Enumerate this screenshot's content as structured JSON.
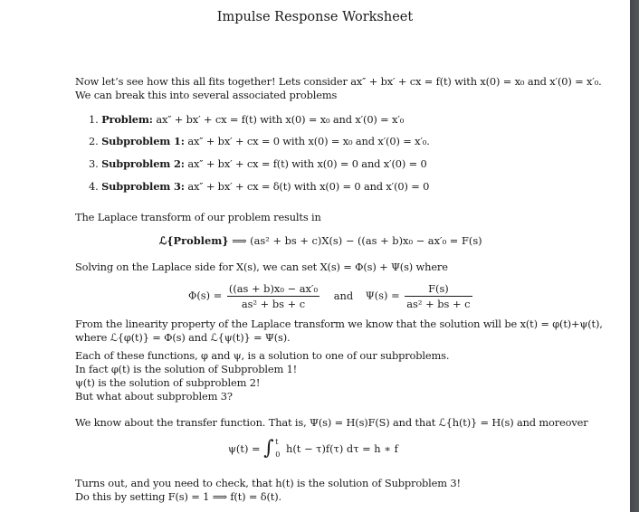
{
  "document": {
    "title": "Impulse Response Worksheet",
    "intro_line1": "Now let’s see how this all fits together! Lets consider ax″ + bx′ + cx = f(t) with x(0) = x₀ and x′(0) = x′₀.",
    "intro_line2": "We can break this into several associated problems",
    "problems": [
      {
        "number": "1.",
        "label": "Problem:",
        "text": "ax″ + bx′ + cx = f(t) with x(0) = x₀ and x′(0) = x′₀"
      },
      {
        "number": "2.",
        "label": "Subproblem 1:",
        "text": "ax″ + bx′ + cx = 0 with x(0) = x₀ and x′(0) = x′₀."
      },
      {
        "number": "3.",
        "label": "Subproblem 2:",
        "text": "ax″ + bx′ + cx = f(t) with x(0) = 0 and x′(0) = 0"
      },
      {
        "number": "4.",
        "label": "Subproblem 3:",
        "text": "ax″ + bx′ + cx = δ(t) with x(0) = 0 and x′(0) = 0"
      }
    ],
    "laplace_intro": "The Laplace transform of our problem results in",
    "laplace_eq_lhs": "ℒ{Problem}",
    "laplace_eq_rhs": "⟹  (as² + bs + c)X(s) − ((as + b)x₀ − ax′₀ = F(s)",
    "solving_line": "Solving on the Laplace side for X(s), we can set X(s) = Φ(s) + Ψ(s) where",
    "phi_lhs": "Φ(s) =",
    "phi_num": "((as + b)x₀ − ax′₀",
    "phi_den": "as² + bs + c",
    "and_word": "and",
    "psi_lhs": "Ψ(s) =",
    "psi_num": "F(s)",
    "psi_den": "as² + bs + c",
    "linearity_line1": "From the linearity property of the Laplace transform we know that the solution will be x(t) = φ(t)+ψ(t),",
    "linearity_line2": "where ℒ{φ(t)} = Φ(s) and ℒ{ψ(t)} = Ψ(s).",
    "each_lines": [
      "Each of these functions, φ and ψ, is a solution to one of our subproblems.",
      "In fact φ(t) is the solution of Subproblem 1!",
      "ψ(t) is the solution of subproblem 2!",
      "But what about subproblem 3?"
    ],
    "transfer_line": "We know about the transfer function. That is, Ψ(s) = H(s)F(S) and that ℒ{h(t)} = H(s) and moreover",
    "conv_lhs": "ψ(t) =",
    "conv_integral": "∫",
    "conv_upper": "t",
    "conv_lower": "0",
    "conv_rhs": "h(t − τ)f(τ) dτ = h ∗ f",
    "closing_lines": [
      "Turns out, and you need to check, that h(t) is the solution of Subproblem 3!",
      "Do this by setting F(s) = 1  ⟹  f(t) = δ(t)."
    ]
  }
}
